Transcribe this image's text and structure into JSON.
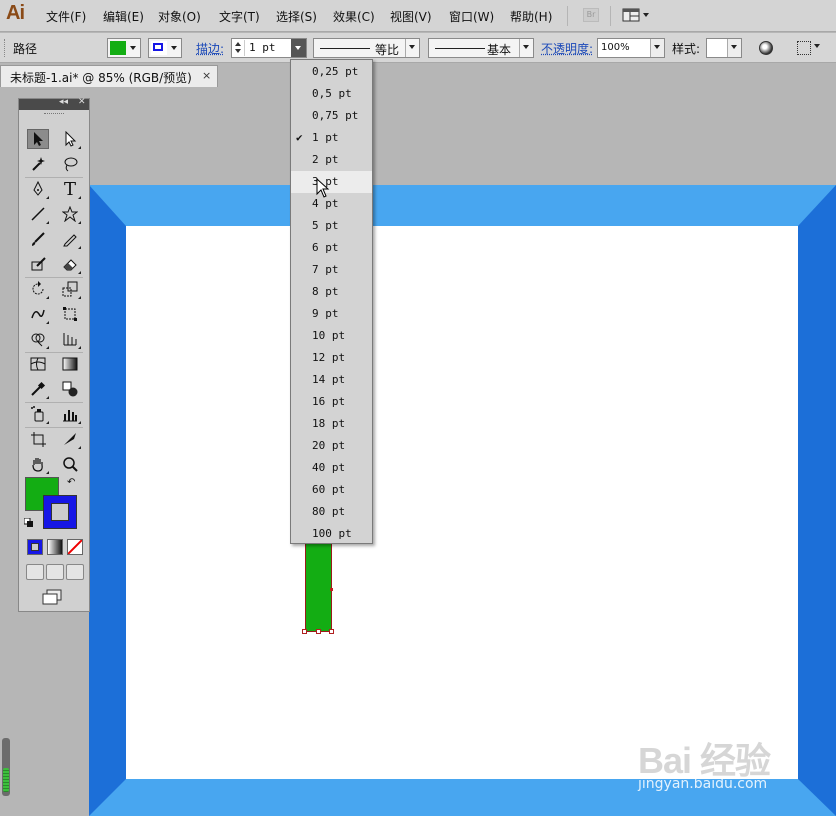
{
  "app": {
    "logo": "Ai",
    "menu": [
      "文件(F)",
      "编辑(E)",
      "对象(O)",
      "文字(T)",
      "选择(S)",
      "效果(C)",
      "视图(V)",
      "窗口(W)",
      "帮助(H)"
    ],
    "bridge_label": "Br"
  },
  "control_bar": {
    "object_type": "路径",
    "fill_color": "#13ad13",
    "stroke_color": "#1616e6",
    "stroke_label": "描边:",
    "stroke_weight": "1 pt",
    "variable_width": "等比",
    "brush": "基本",
    "opacity_label": "不透明度:",
    "opacity_value": "100%",
    "style_label": "样式:"
  },
  "document_tab": {
    "title": "未标题-1.ai* @ 85% (RGB/预览)",
    "close": "×"
  },
  "stroke_dropdown": {
    "selected": "1 pt",
    "hovered": "3 pt",
    "items": [
      "0,25 pt",
      "0,5 pt",
      "0,75 pt",
      "1 pt",
      "2 pt",
      "3 pt",
      "4 pt",
      "5 pt",
      "6 pt",
      "7 pt",
      "8 pt",
      "9 pt",
      "10 pt",
      "12 pt",
      "14 pt",
      "16 pt",
      "18 pt",
      "20 pt",
      "40 pt",
      "60 pt",
      "80 pt",
      "100 pt"
    ],
    "check": "✔"
  },
  "tools": {
    "type_glyph": "T",
    "collapse": "◂◂",
    "close": "✕",
    "swap": "↶"
  },
  "canvas": {
    "frame_color": "#48a6f0",
    "frame_dark_color": "#1c6fd8",
    "shape_color": "#13ad13"
  },
  "watermark": {
    "brand": "Bai 经验",
    "url": "jingyan.baidu.com"
  }
}
